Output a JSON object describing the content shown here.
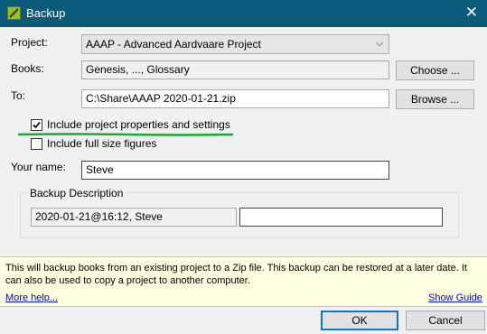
{
  "window": {
    "title": "Backup"
  },
  "form": {
    "project_label": "Project:",
    "project_value": "AAAP -  Advanced Aardvaare Project",
    "books_label": "Books:",
    "books_value": "Genesis, ..., Glossary",
    "choose_label": "Choose ...",
    "to_label": "To:",
    "to_value": "C:\\Share\\AAAP 2020-01-21.zip",
    "browse_label": "Browse ...",
    "include_props_label": "Include project properties and settings",
    "include_props_checked": true,
    "include_figures_label": "Include full size figures",
    "include_figures_checked": false,
    "name_label": "Your name:",
    "name_value": "Steve"
  },
  "description": {
    "group_label": "Backup Description",
    "auto_value": "2020-01-21@16:12, Steve",
    "extra_value": ""
  },
  "info": {
    "text": "This will backup books from an existing project to a Zip file. This backup can be restored at a later date. It can also be used to copy a project to another computer.",
    "more_help": "More help...",
    "show_guide": "Show Guide"
  },
  "buttons": {
    "ok": "OK",
    "cancel": "Cancel"
  },
  "colors": {
    "titlebar": "#0a5a7a",
    "info_background": "#ffffe1",
    "annotation_underline": "#1ea53c",
    "default_button_border": "#0078d7"
  }
}
